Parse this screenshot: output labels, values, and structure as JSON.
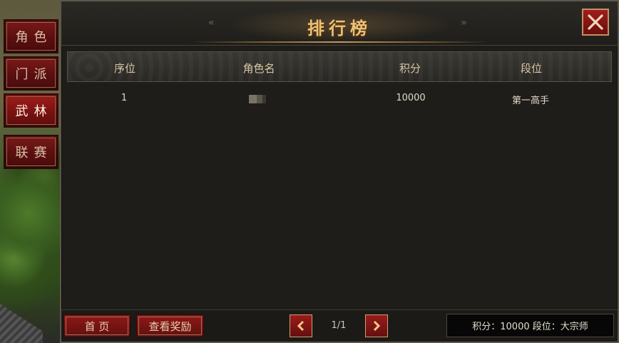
{
  "window": {
    "title": "排行榜"
  },
  "side_tabs": [
    {
      "label": "角色",
      "active": false
    },
    {
      "label": "门派",
      "active": false
    },
    {
      "label": "武林",
      "active": true
    },
    {
      "label": "联赛",
      "active": false
    }
  ],
  "table": {
    "headers": [
      "序位",
      "角色名",
      "积分",
      "段位"
    ],
    "rows": [
      {
        "rank": "1",
        "name": "",
        "score": "10000",
        "tier": "第一高手"
      }
    ]
  },
  "footer": {
    "home_label": "首 页",
    "rewards_label": "查看奖励",
    "page": "1/1",
    "my_score": "积分：10000 段位：大宗师"
  },
  "icons": {
    "close": "close-icon",
    "prev": "chevron-left-icon",
    "next": "chevron-right-icon",
    "title_deco_left": "double-chevron-left-icon",
    "title_deco_right": "double-chevron-right-icon"
  },
  "colors": {
    "accent_gold": "#e8c27a",
    "button_red": "#8e1818",
    "panel_bg": "#1e1d19"
  }
}
